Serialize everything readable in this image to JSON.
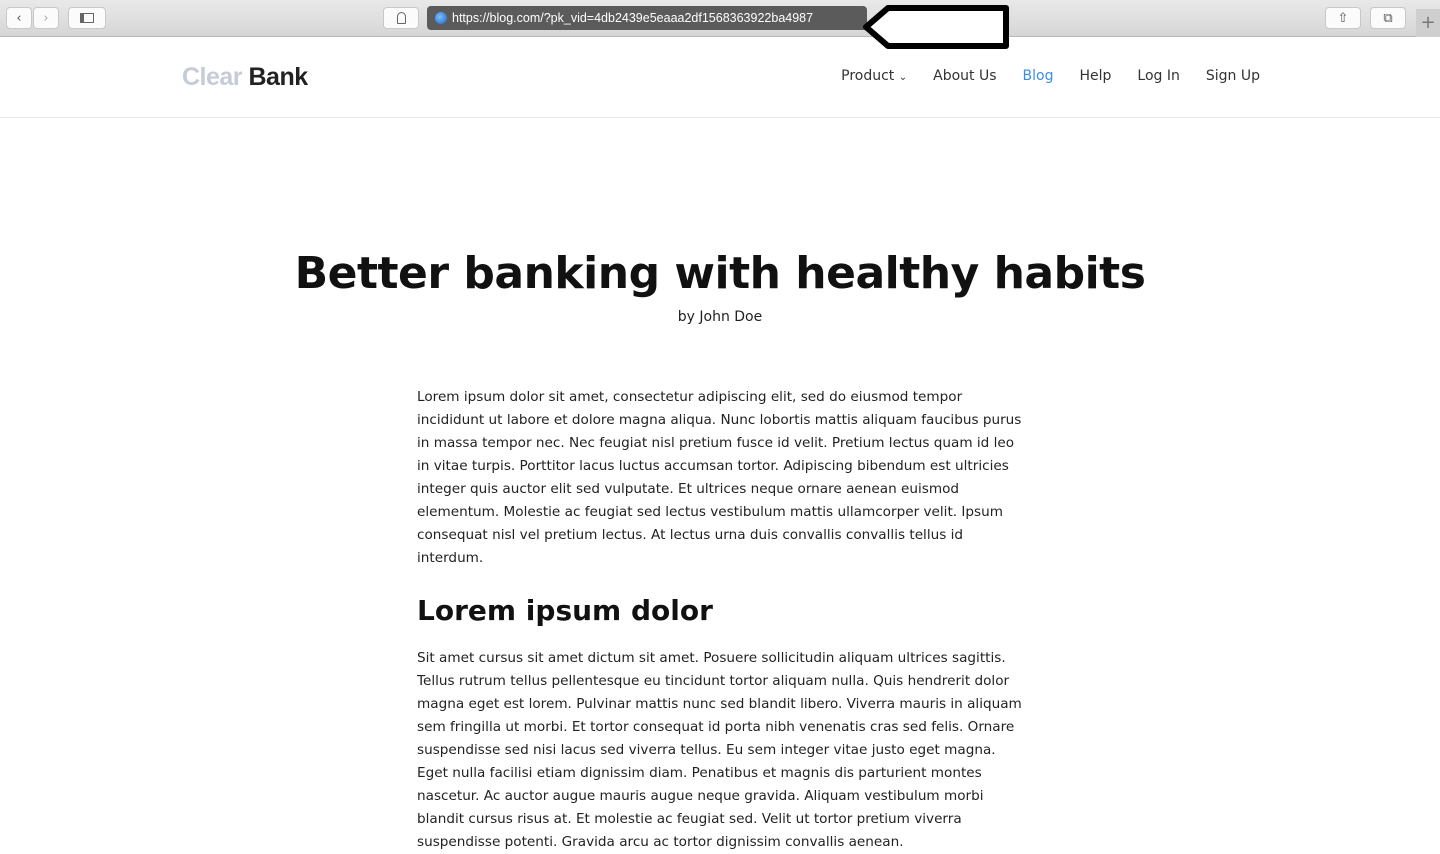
{
  "browser": {
    "url": "https://blog.com/?pk_vid=4db2439e5eaaa2df1568363922ba4987",
    "icons": [
      "back-icon",
      "forward-icon",
      "sidebar-icon",
      "ghostery-icon",
      "globe-icon",
      "share-icon",
      "tabs-icon",
      "new-tab-icon"
    ]
  },
  "header": {
    "logo_light": "Clear",
    "logo_dark": "Bank",
    "nav": [
      {
        "label": "Product"
      },
      {
        "label": "About Us"
      },
      {
        "label": "Blog"
      },
      {
        "label": "Help"
      },
      {
        "label": "Log In"
      },
      {
        "label": "Sign Up"
      }
    ],
    "accent": "#3a8ee6"
  },
  "article": {
    "title": "Better banking with healthy habits",
    "byline": "by John Doe",
    "p1": "Lorem ipsum dolor sit amet, consectetur adipiscing elit, sed do eiusmod tempor incididunt ut labore et dolore magna aliqua. Nunc lobortis mattis aliquam faucibus purus in massa tempor nec. Nec feugiat nisl pretium fusce id velit. Pretium lectus quam id leo in vitae turpis. Porttitor lacus luctus accumsan tortor. Adipiscing bibendum est ultricies integer quis auctor elit sed vulputate. Et ultrices neque ornare aenean euismod elementum. Molestie ac feugiat sed lectus vestibulum mattis ullamcorper velit. Ipsum consequat nisl vel pretium lectus. At lectus urna duis convallis convallis tellus id interdum.",
    "h2": "Lorem ipsum dolor",
    "p2": "Sit amet cursus sit amet dictum sit amet. Posuere sollicitudin aliquam ultrices sagittis. Tellus rutrum tellus pellentesque eu tincidunt tortor aliquam nulla. Quis hendrerit dolor magna eget est lorem. Pulvinar mattis nunc sed blandit libero. Viverra mauris in aliquam sem fringilla ut morbi. Et tortor consequat id porta nibh venenatis cras sed felis. Ornare suspendisse sed nisi lacus sed viverra tellus. Eu sem integer vitae justo eget magna. Eget nulla facilisi etiam dignissim diam. Penatibus et magnis dis parturient montes nascetur. Ac auctor augue mauris augue neque gravida. Aliquam vestibulum morbi blandit cursus risus at. Et molestie ac feugiat sed. Velit ut tortor pretium viverra suspendisse potenti. Gravida arcu ac tortor dignissim convallis aenean."
  }
}
